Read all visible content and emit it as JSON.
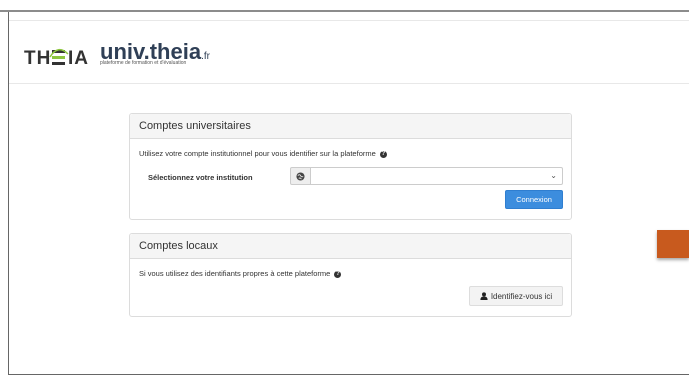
{
  "header": {
    "logo_text": "THEIA",
    "brand_main": "univ.theia",
    "brand_suffix": ".fr",
    "brand_tagline": "plateforme de formation et d'évaluation"
  },
  "university_panel": {
    "title": "Comptes universitaires",
    "description": "Utilisez votre compte institutionnel pour vous identifier sur la plateforme",
    "institution_label": "Sélectionnez votre institution",
    "institution_select_value": "",
    "submit_label": "Connexion",
    "addon_icon": "globe-icon"
  },
  "local_panel": {
    "title": "Comptes locaux",
    "description": "Si vous utilisez des identifiants propres à cette plateforme",
    "button_label": "Identifiez-vous ici",
    "button_icon": "user-icon"
  },
  "colors": {
    "primary": "#3c8dde",
    "accent_orange": "#c85a1e",
    "brand_green": "#8dc63f",
    "brand_navy": "#2f3f56"
  }
}
